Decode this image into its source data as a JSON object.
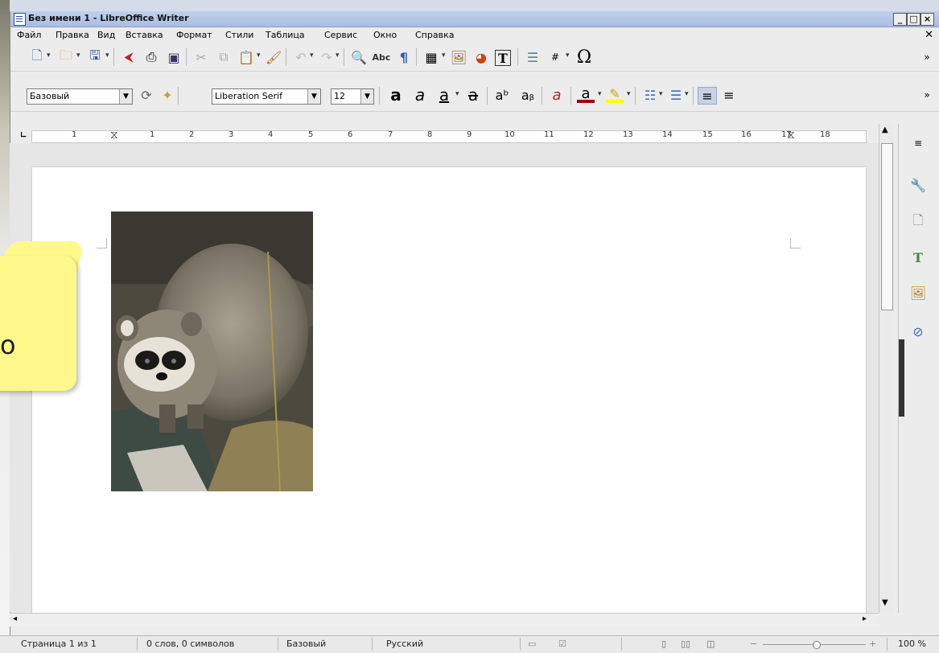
{
  "window": {
    "title": "Без имени 1 - LibreOffice Writer"
  },
  "menu": [
    "Файл",
    "Правка",
    "Вид",
    "Вставка",
    "Формат",
    "Стили",
    "Таблица",
    "Сервис",
    "Окно",
    "Справка"
  ],
  "toolbar2": {
    "paragraph_style": "Базовый",
    "font_name": "Liberation Serif",
    "font_size": "12"
  },
  "ruler": {
    "numbers": [
      "1",
      "1",
      "2",
      "3",
      "4",
      "5",
      "6",
      "7",
      "8",
      "9",
      "10",
      "11",
      "12",
      "13",
      "14",
      "15",
      "16",
      "17",
      "18"
    ]
  },
  "icons": {
    "special_char": "Ω"
  },
  "callout": {
    "text": "о"
  },
  "statusbar": {
    "page": "Страница 1 из 1",
    "words": "0 слов, 0 символов",
    "style": "Базовый",
    "language": "Русский",
    "zoom": "100 %"
  },
  "colors": {
    "titlebar": "#a9bee3",
    "callout": "#fef98a",
    "font_color": "#c00000",
    "highlight": "#ffff00"
  }
}
